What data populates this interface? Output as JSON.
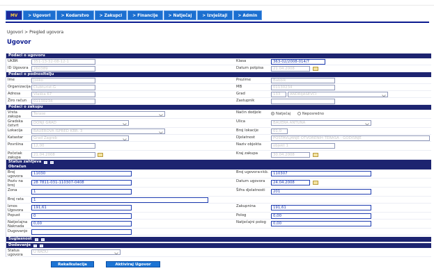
{
  "nav": [
    "MV",
    "> Ugovori",
    "> Kodarstvo",
    "> Zakupci",
    "> Financije",
    "> Natječaj",
    "> Izvještaji",
    "> Admin"
  ],
  "breadcrumb": "Ugovori > Pregled ugovora",
  "page_title": "Ugovor",
  "sections": {
    "ugovor": "Podaci o ugovoru",
    "podnositelj": "Podaci o podnositelju",
    "zakup": "Podaci o zakupu",
    "status_zaht": "Status zahtjeva",
    "obracun": "Obračun",
    "suglasnost": "Suglasnost",
    "dodavanje": "Dodavanje"
  },
  "ugovor": {
    "ukbr_label": "UKBR",
    "ukbr": "351-13-32-08-12-1",
    "id_label": "ID Ugovora",
    "id": "260389",
    "klasa_label": "Klasa",
    "klasa": "363-02/2008-014/7",
    "datum_label": "Datum potpisa",
    "datum": "21.04.2008"
  },
  "podnositelj": {
    "ime_label": "Ime",
    "ime": "Joško",
    "org_label": "Organizacija",
    "org": "Clubturist.G",
    "adresa_label": "Adresa",
    "adresa": "Vlaška 67",
    "ziro_label": "Žiro račun",
    "ziro": "01130234",
    "prezime_label": "Prezime",
    "prezime": "Babbik",
    "mb_label": "MB",
    "mb": "01130234",
    "grad_label": "Grad",
    "grad_num": "133",
    "grad": "ANDRIJAŠEVCI",
    "zastupnik_label": "Zastupnik",
    "zastupnik": ""
  },
  "zakup": {
    "vrsta_label": "Vrsta zakupa",
    "vrsta": "Terase",
    "gradska_label": "Gradska četvrt",
    "gradska": "DONJI GRAD",
    "lokacija_label": "Lokacija",
    "lokacija": "BAUEROVA ISPRED KBR. 3",
    "katastar_label": "Katastar",
    "katastar": "Grad Zagreb",
    "povrsina_label": "Površina",
    "povrsina": "12,00",
    "pocetak_label": "Početak zakupa",
    "pocetak": "21.04.2008",
    "nacin_label": "Način dodjele",
    "nacin_opt1": "Natječaj",
    "nacin_opt2": "Neposredno",
    "ulica_label": "Ulica",
    "ulica": "BAUERA ANTUNA",
    "brlok_label": "Broj lokacije",
    "brlok": "01,0",
    "djelatnost_label": "Djelatnost",
    "djelatnost": "POSTAVLJANJE OTVORENIH TERASA - GODIŠNJE",
    "naziv_label": "Naziv objekta",
    "naziv": "objekt 1",
    "kraj_label": "Kraj zakupa",
    "kraj": "30.04.2008"
  },
  "obracun": {
    "broj_label": "Broj ugovora",
    "broj": "11030",
    "poziv_label": "Poziv na broj",
    "poziv": "28 7811-031-110307-0408",
    "zona_label": "Zona",
    "zona": "1",
    "rata_label": "Broj rata",
    "rata": "1",
    "iznos_label": "Iznos Ugovora",
    "iznos": "191,61",
    "popust_label": "Popust",
    "popust": "0",
    "natjecajna_label": "Natječajna Naknada",
    "natjecajna": "0,00",
    "dugovanje_label": "Dugovanje",
    "dugovanje": "",
    "brojkb_label": "Broj ugovora+kb.",
    "brojkb": "110307",
    "datum_label": "Datum ugovora",
    "datum": "24.04.2008",
    "sifra_label": "Šifra djelatnosti",
    "sifra": "201",
    "zakupnina_label": "Zakupnina",
    "zakupnina": "191,61",
    "polog_label": "Polog",
    "polog": "0,00",
    "natpolog_label": "Natječajni polog",
    "natpolog": "0,00"
  },
  "dodavanje": {
    "status_label": "Status ugovora",
    "status": "U RADU"
  },
  "buttons": {
    "rekalk": "Rekalkulacija",
    "aktiviraj": "Aktiviraj Ugovor"
  }
}
